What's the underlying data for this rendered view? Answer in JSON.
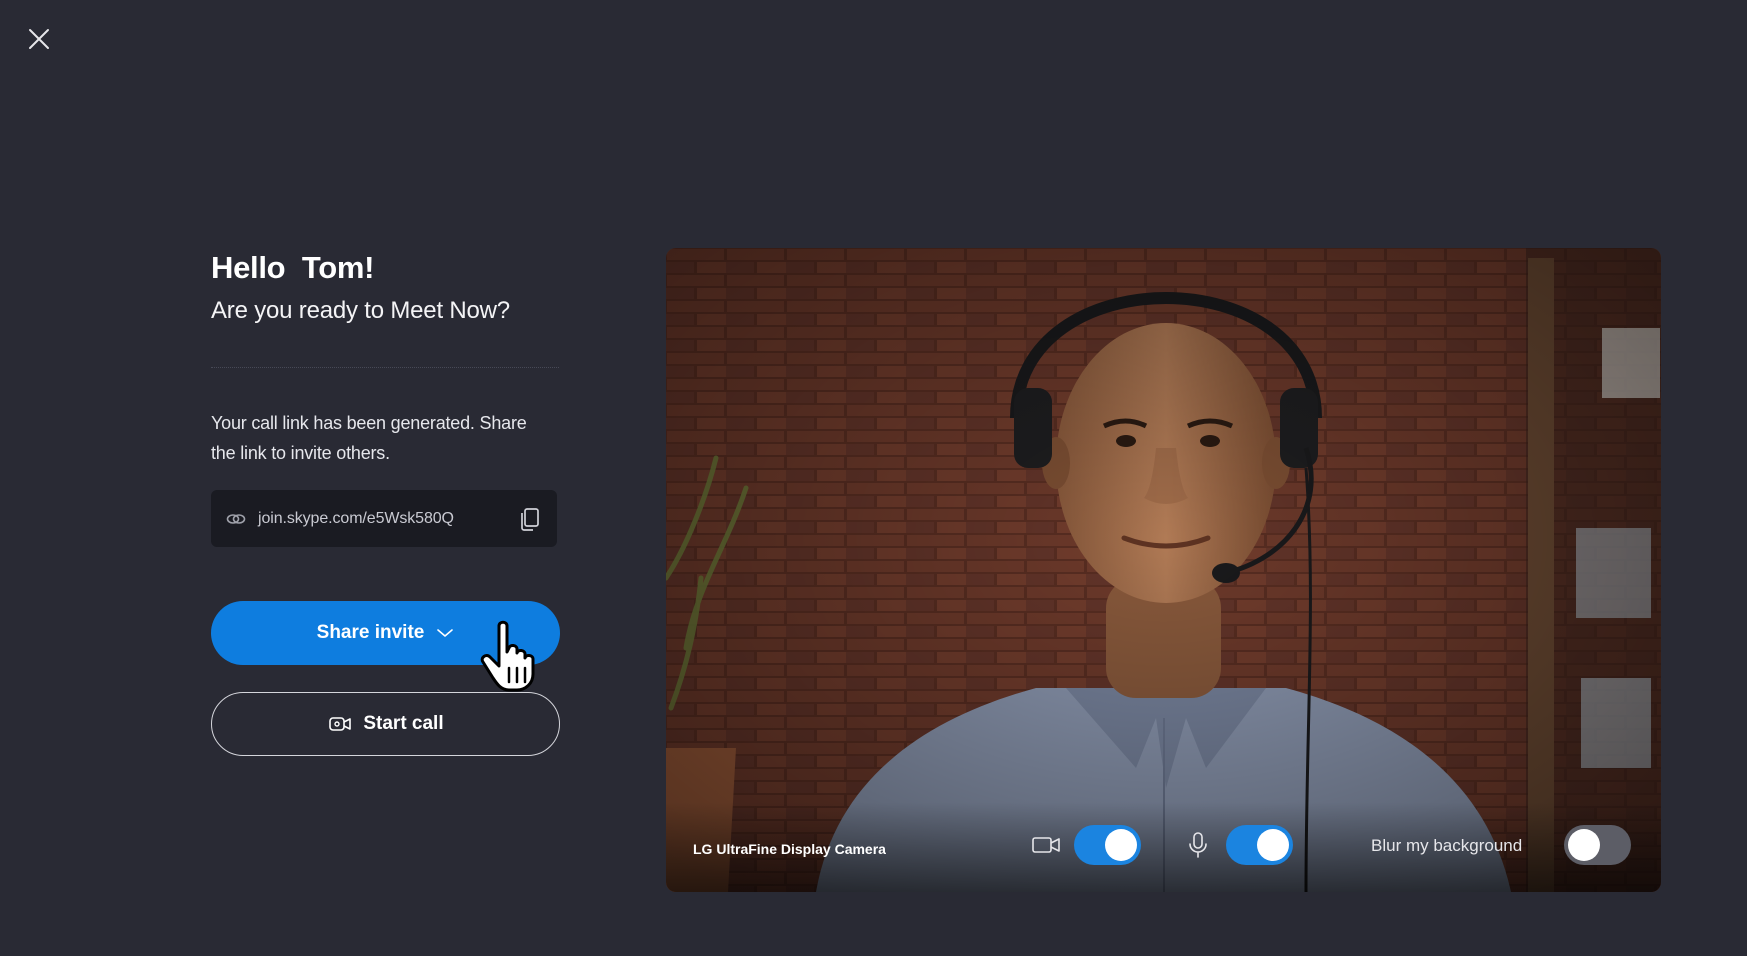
{
  "close": {
    "icon": "close-icon"
  },
  "greeting": "Hello  Tom!",
  "subtitle": "Are you ready to Meet Now?",
  "info_text_line1": "Your call link has been generated. Share",
  "info_text_line2": "the link to invite others.",
  "link": {
    "icon": "link-icon",
    "url": "join.skype.com/e5Wsk580Q",
    "copy_icon": "copy-icon"
  },
  "share_button": {
    "label": "Share invite",
    "icon": "chevron-down-icon"
  },
  "start_button": {
    "label": "Start call",
    "icon": "video-call-icon"
  },
  "preview": {
    "camera_name": "LG UltraFine Display Camera",
    "video_toggle": {
      "icon": "camera-icon",
      "on": true
    },
    "mic_toggle": {
      "icon": "microphone-icon",
      "on": true
    },
    "blur_label": "Blur my background",
    "blur_toggle": {
      "on": false
    }
  },
  "colors": {
    "background": "#292a34",
    "accent": "#0e7ddf",
    "link_box": "#1a1b22",
    "toggle_on": "#1b84e0",
    "toggle_off": "#5c5d66"
  }
}
